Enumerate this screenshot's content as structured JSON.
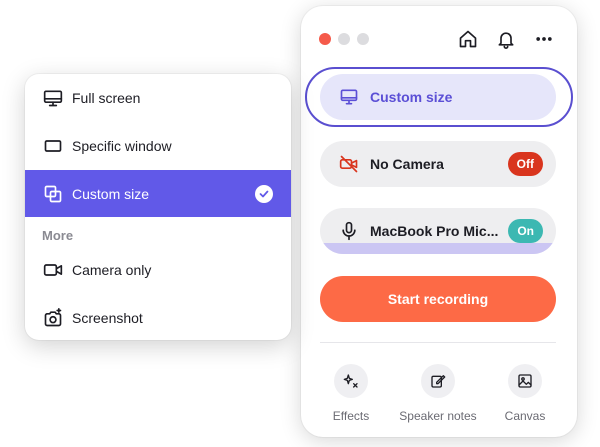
{
  "source_menu": {
    "items": [
      {
        "label": "Full screen",
        "icon": "monitor-icon",
        "selected": false
      },
      {
        "label": "Specific window",
        "icon": "window-icon",
        "selected": false
      },
      {
        "label": "Custom size",
        "icon": "custom-size-icon",
        "selected": true
      }
    ],
    "section_label": "More",
    "more_items": [
      {
        "label": "Camera only",
        "icon": "video-camera-icon"
      },
      {
        "label": "Screenshot",
        "icon": "screenshot-camera-icon"
      }
    ],
    "selected_color": "#6159e8"
  },
  "recorder": {
    "window_controls": [
      "close",
      "minimize",
      "maximize"
    ],
    "top_icons": [
      "home-icon",
      "bell-icon",
      "more-icon"
    ],
    "source_label": "Custom size",
    "camera": {
      "label": "No Camera",
      "status": "Off",
      "status_color": "#d9351e"
    },
    "microphone": {
      "label": "MacBook Pro Mic...",
      "status": "On",
      "status_color": "#3cb8b2"
    },
    "record_label": "Start recording",
    "record_color": "#fd6a46",
    "tools": [
      {
        "label": "Effects",
        "icon": "sparkle-icon"
      },
      {
        "label": "Speaker notes",
        "icon": "edit-icon"
      },
      {
        "label": "Canvas",
        "icon": "image-icon"
      }
    ],
    "accent_color": "#5a4fd0"
  }
}
